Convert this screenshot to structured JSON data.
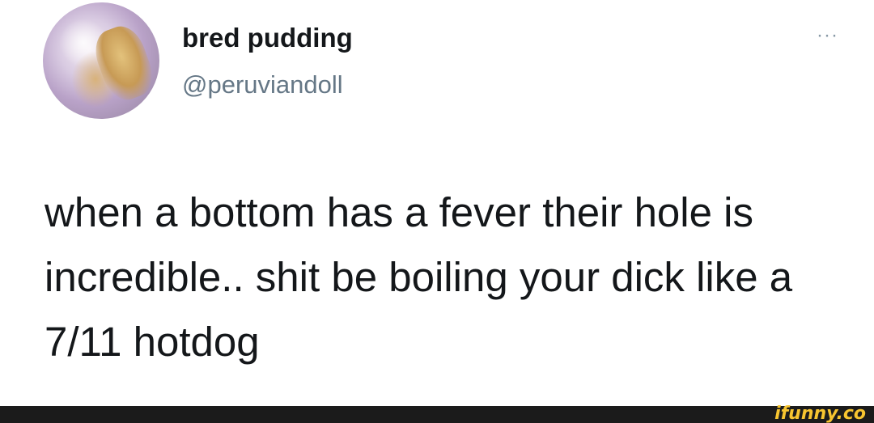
{
  "tweet": {
    "display_name": "bred pudding",
    "handle": "@peruviandoll",
    "more_menu": "···",
    "text": "when a bottom has a fever their hole is incredible.. shit be boiling your dick like a 7/11 hotdog"
  },
  "watermark": {
    "text": "ifunny.co"
  },
  "colors": {
    "text": "#14171a",
    "handle": "#657786",
    "footer_bar": "#1b1b1b",
    "watermark": "#f7c530"
  }
}
